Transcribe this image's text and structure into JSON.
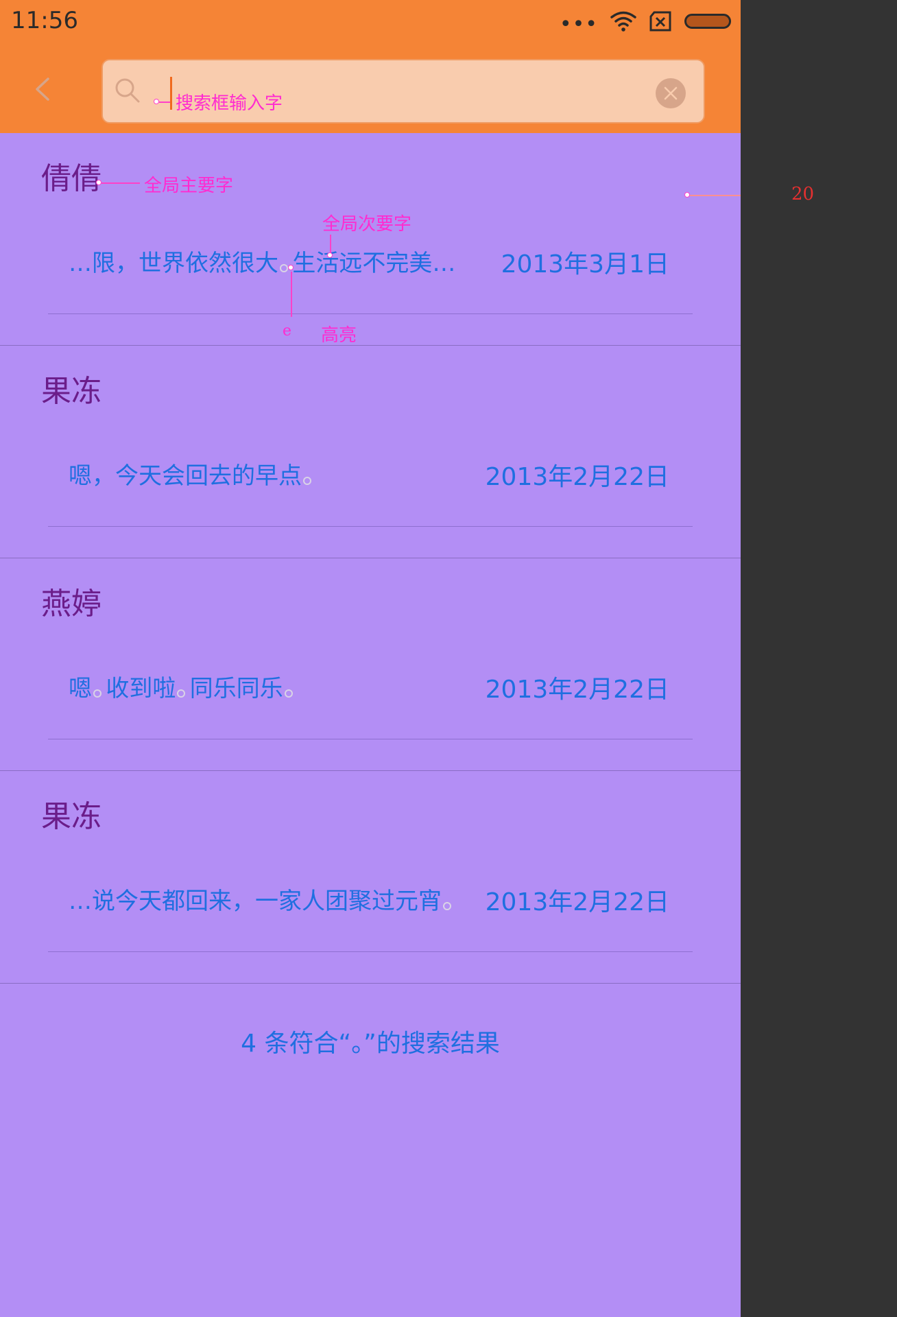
{
  "status_bar": {
    "time": "11:56",
    "dots": "•••"
  },
  "search": {
    "query": "。",
    "annotation": "搜索框输入字"
  },
  "results": [
    {
      "contact": "倩倩",
      "snippet_parts": [
        "…限，世界依然很大",
        "生活远不完美…"
      ],
      "date": "2013年3月1日"
    },
    {
      "contact": "果冻",
      "snippet_parts": [
        "嗯，今天会回去的早点",
        ""
      ],
      "date": "2013年2月22日"
    },
    {
      "contact": "燕婷",
      "snippet_parts": [
        "嗯",
        "收到啦",
        "同乐同乐",
        ""
      ],
      "date": "2013年2月22日"
    },
    {
      "contact": "果冻",
      "snippet_parts": [
        "…说今天都回来，一家人团聚过元宵",
        ""
      ],
      "date": "2013年2月22日"
    }
  ],
  "footer": {
    "summary": "4 条符合“。”的搜索结果"
  },
  "annotations": {
    "primary_text": "全局主要字",
    "secondary_text": "全局次要字",
    "highlight": "高亮",
    "highlight_marker": "e",
    "spacing": "20"
  },
  "colors": {
    "statusbar": "#f58436",
    "search_box": "#f9ccae",
    "background": "#b38ef5",
    "primary_text": "#6b1d8a",
    "secondary_text": "#1f6fe0",
    "annotation": "#ff2bd0"
  }
}
